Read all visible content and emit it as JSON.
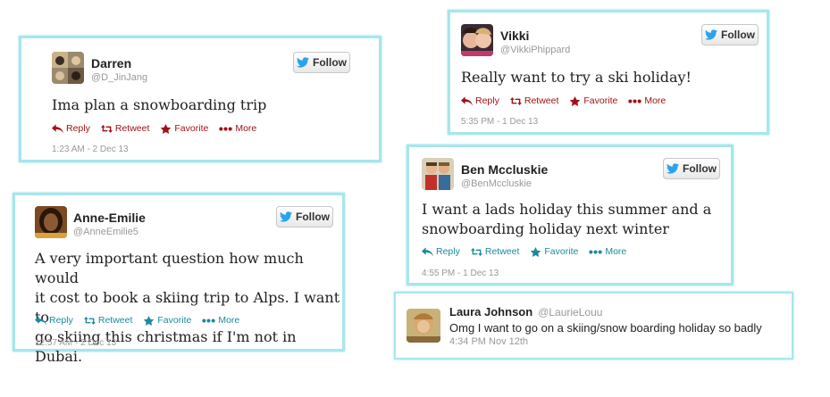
{
  "colors": {
    "card_border": "#a7e6ec",
    "action_red": "#a01116",
    "action_teal": "#1b8a9f",
    "follow_bird": "#2aa3ef"
  },
  "common": {
    "follow_label": "Follow",
    "reply": "Reply",
    "retweet": "Retweet",
    "favorite": "Favorite",
    "more": "More"
  },
  "tweets": [
    {
      "name": "Darren",
      "handle": "@D_JinJang",
      "text": "Ima plan a snowboarding trip",
      "timestamp": "1:23 AM - 2 Dec 13",
      "action_color": "red"
    },
    {
      "name": "Anne-Emilie",
      "handle": "@AnneEmilie5",
      "text_lines": [
        "A very important question how much would",
        "it cost to book a skiing trip to Alps. I want to",
        "go skiing this christmas if I'm not in Dubai."
      ],
      "timestamp": "12:57 AM - 2 Dec 13",
      "action_color": "teal"
    },
    {
      "name": "Vikki",
      "handle": "@VikkiPhippard",
      "text": "Really want to try a ski holiday!",
      "timestamp": "5:35 PM - 1 Dec 13",
      "action_color": "red"
    },
    {
      "name": "Ben Mccluskie",
      "handle": "@BenMccluskie",
      "text_lines": [
        "I want a lads holiday this summer and a",
        "snowboarding holiday next winter"
      ],
      "timestamp": "4:55 PM - 1 Dec 13",
      "action_color": "teal"
    },
    {
      "name": "Laura Johnson",
      "handle": "@LaurieLouu",
      "text": "Omg I want to go on a skiing/snow boarding holiday so badly",
      "timestamp": "4:34 PM Nov 12th",
      "style": "compact"
    }
  ]
}
